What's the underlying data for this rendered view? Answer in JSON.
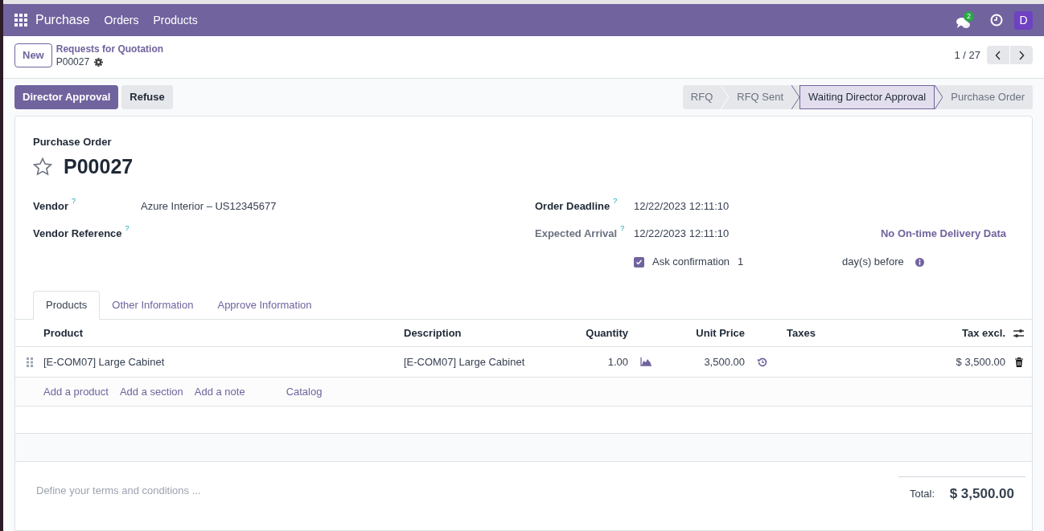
{
  "navbar": {
    "app_name": "Purchase",
    "menu": [
      "Orders",
      "Products"
    ],
    "messages_badge": "2",
    "avatar": "D"
  },
  "control_panel": {
    "new_button": "New",
    "breadcrumb_parent": "Requests for Quotation",
    "breadcrumb_current": "P00027",
    "pager": "1 / 27"
  },
  "actions": [
    {
      "label": "Director Approval",
      "kind": "primary"
    },
    {
      "label": "Refuse",
      "kind": "secondary"
    }
  ],
  "statusbar": [
    {
      "label": "RFQ",
      "selected": false
    },
    {
      "label": "RFQ Sent",
      "selected": false
    },
    {
      "label": "Waiting Director Approval",
      "selected": true
    },
    {
      "label": "Purchase Order",
      "selected": false
    }
  ],
  "sheet": {
    "title_label": "Purchase Order",
    "name": "P00027",
    "starred": false,
    "left_fields": [
      {
        "label": "Vendor",
        "help": "?",
        "value": "Azure Interior – US12345677",
        "muted": false
      },
      {
        "label": "Vendor Reference",
        "help": "?",
        "muted": false
      }
    ],
    "right_fields": [
      {
        "label": "Order Deadline",
        "help": "?",
        "value": "12/22/2023 12:11:10",
        "muted": false
      },
      {
        "label": "Expected Arrival",
        "help": "?",
        "value": "12/22/2023 12:11:10",
        "muted": true,
        "link": "No On-time Delivery Data"
      }
    ],
    "ask_confirmation": {
      "checked": true,
      "label": "Ask confirmation",
      "days": "1",
      "suffix": "day(s) before"
    },
    "tabs": [
      {
        "label": "Products",
        "selected": true
      },
      {
        "label": "Other Information",
        "selected": false
      },
      {
        "label": "Approve Information",
        "selected": false
      }
    ],
    "table": {
      "columns": [
        "Product",
        "Description",
        "Quantity",
        "Unit Price",
        "Taxes",
        "Tax excl."
      ],
      "rows": [
        {
          "product": "[E-COM07] Large Cabinet",
          "description": "[E-COM07] Large Cabinet",
          "quantity": "1.00",
          "unit_price": "3,500.00",
          "subtotal": "$ 3,500.00"
        }
      ],
      "add_links": [
        "Add a product",
        "Add a section",
        "Add a note",
        "Catalog"
      ]
    },
    "terms_placeholder": "Define your terms and conditions ...",
    "total_label": "Total:",
    "total": "$ 3,500.00"
  }
}
